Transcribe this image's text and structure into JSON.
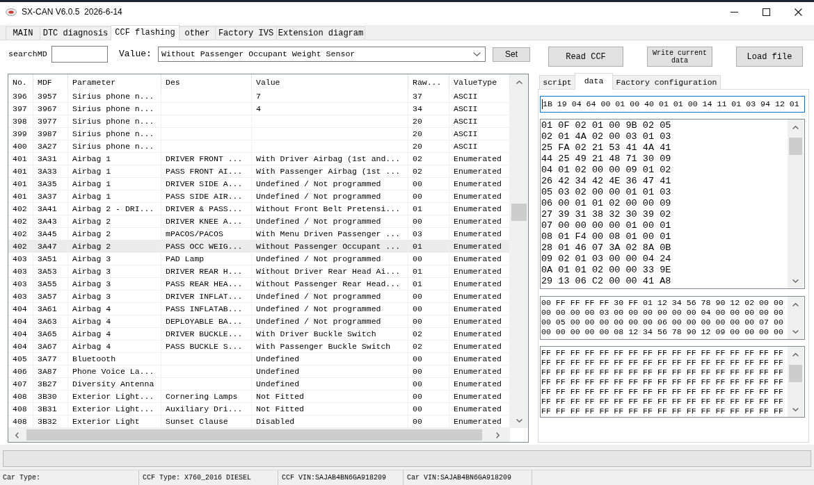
{
  "window": {
    "title": "SX-CAN V6.0.5  2026-6-14"
  },
  "tabs": [
    {
      "label": "MAIN",
      "selected": false
    },
    {
      "label": "DTC diagnosis",
      "selected": false
    },
    {
      "label": "CCF flashing",
      "selected": true
    },
    {
      "label": "other",
      "selected": false
    },
    {
      "label": "Factory IVS",
      "selected": false
    },
    {
      "label": "Extension diagram",
      "selected": false
    }
  ],
  "search": {
    "label": "searchMD"
  },
  "value_field": {
    "label": "Value:",
    "value": "Without Passenger Occupant Weight Sensor"
  },
  "set_button": "Set",
  "action_buttons": [
    "Read CCF",
    "Write current data",
    "Load file"
  ],
  "table": {
    "columns": [
      "No.",
      "MDF",
      "Parameter",
      "Des",
      "Value",
      "Raw...",
      "ValueType"
    ],
    "rows": [
      {
        "no": "396",
        "mdf": "3957",
        "parameter": "Sirius phone n...",
        "value": "7",
        "raw": "37",
        "value_type": "ASCII",
        "selected": false
      },
      {
        "no": "397",
        "mdf": "3967",
        "parameter": "Sirius phone n...",
        "value": "4",
        "raw": "34",
        "value_type": "ASCII",
        "selected": false
      },
      {
        "no": "398",
        "mdf": "3977",
        "parameter": "Sirius phone n...",
        "raw": "20",
        "value_type": "ASCII",
        "selected": false
      },
      {
        "no": "399",
        "mdf": "3987",
        "parameter": "Sirius phone n...",
        "raw": "20",
        "value_type": "ASCII",
        "selected": false
      },
      {
        "no": "400",
        "mdf": "3A27",
        "parameter": "Sirius phone n...",
        "raw": "20",
        "value_type": "ASCII",
        "selected": false
      },
      {
        "no": "401",
        "mdf": "3A31",
        "parameter": "Airbag 1",
        "des": "DRIVER FRONT ...",
        "value": "With Driver Airbag (1st and...",
        "raw": "02",
        "value_type": "Enumerated",
        "selected": false
      },
      {
        "no": "401",
        "mdf": "3A33",
        "parameter": "Airbag 1",
        "des": "PASS FRONT AI...",
        "value": "With Passenger Airbag (1st ...",
        "raw": "02",
        "value_type": "Enumerated",
        "selected": false
      },
      {
        "no": "401",
        "mdf": "3A35",
        "parameter": "Airbag 1",
        "des": "DRIVER SIDE A...",
        "value": "Undefined / Not programmed",
        "raw": "00",
        "value_type": "Enumerated",
        "selected": false
      },
      {
        "no": "401",
        "mdf": "3A37",
        "parameter": "Airbag 1",
        "des": "PASS SIDE AIR...",
        "value": "Undefined / Not programmed",
        "raw": "00",
        "value_type": "Enumerated",
        "selected": false
      },
      {
        "no": "402",
        "mdf": "3A41",
        "parameter": "Airbag 2 - DRI...",
        "des": "DRIVER & PASS...",
        "value": "Without Front Belt Pretensi...",
        "raw": "01",
        "value_type": "Enumerated",
        "selected": false
      },
      {
        "no": "402",
        "mdf": "3A43",
        "parameter": "Airbag 2",
        "des": "DRIVER KNEE A...",
        "value": "Undefined / Not programmed",
        "raw": "00",
        "value_type": "Enumerated",
        "selected": false
      },
      {
        "no": "402",
        "mdf": "3A45",
        "parameter": "Airbag 2",
        "des": "mPACOS/PACOS",
        "value": "With Menu Driven Passenger ...",
        "raw": "03",
        "value_type": "Enumerated",
        "selected": false
      },
      {
        "no": "402",
        "mdf": "3A47",
        "parameter": "Airbag 2",
        "des": "PASS OCC WEIG...",
        "value": "Without Passenger Occupant ...",
        "raw": "01",
        "value_type": "Enumerated",
        "selected": true
      },
      {
        "no": "403",
        "mdf": "3A51",
        "parameter": "Airbag 3",
        "des": "PAD Lamp",
        "value": "Undefined / Not programmed",
        "raw": "00",
        "value_type": "Enumerated",
        "selected": false
      },
      {
        "no": "403",
        "mdf": "3A53",
        "parameter": "Airbag 3",
        "des": "DRIVER REAR H...",
        "value": "Without Driver Rear Head Ai...",
        "raw": "01",
        "value_type": "Enumerated",
        "selected": false
      },
      {
        "no": "403",
        "mdf": "3A55",
        "parameter": "Airbag 3",
        "des": "PASS REAR HEA...",
        "value": "Without Passenger Rear Head...",
        "raw": "01",
        "value_type": "Enumerated",
        "selected": false
      },
      {
        "no": "403",
        "mdf": "3A57",
        "parameter": "Airbag 3",
        "des": "DRIVER INFLAT...",
        "value": "Undefined / Not programmed",
        "raw": "00",
        "value_type": "Enumerated",
        "selected": false
      },
      {
        "no": "404",
        "mdf": "3A61",
        "parameter": "Airbag 4",
        "des": "PASS INFLATAB...",
        "value": "Undefined / Not programmed",
        "raw": "00",
        "value_type": "Enumerated",
        "selected": false
      },
      {
        "no": "404",
        "mdf": "3A63",
        "parameter": "Airbag 4",
        "des": "DEPLOYABLE BA...",
        "value": "Undefined / Not programmed",
        "raw": "00",
        "value_type": "Enumerated",
        "selected": false
      },
      {
        "no": "404",
        "mdf": "3A65",
        "parameter": "Airbag 4",
        "des": "DRIVER BUCKLE...",
        "value": "With Driver Buckle Switch",
        "raw": "02",
        "value_type": "Enumerated",
        "selected": false
      },
      {
        "no": "404",
        "mdf": "3A67",
        "parameter": "Airbag 4",
        "des": "PASS BUCKLE S...",
        "value": "With Passenger Buckle Switch",
        "raw": "02",
        "value_type": "Enumerated",
        "selected": false
      },
      {
        "no": "405",
        "mdf": "3A77",
        "parameter": "Bluetooth",
        "value": "Undefined",
        "raw": "00",
        "value_type": "Enumerated",
        "selected": false
      },
      {
        "no": "406",
        "mdf": "3A87",
        "parameter": "Phone Voice La...",
        "value": "Undefined",
        "raw": "00",
        "value_type": "Enumerated",
        "selected": false
      },
      {
        "no": "407",
        "mdf": "3B27",
        "parameter": "Diversity Antenna",
        "value": "Undefined",
        "raw": "00",
        "value_type": "Enumerated",
        "selected": false
      },
      {
        "no": "408",
        "mdf": "3B30",
        "parameter": "Exterior Light...",
        "des": "Cornering Lamps",
        "value": "Not Fitted",
        "raw": "00",
        "value_type": "Enumerated",
        "selected": false
      },
      {
        "no": "408",
        "mdf": "3B31",
        "parameter": "Exterior Light...",
        "des": "Auxiliary Dri...",
        "value": "Not Fitted",
        "raw": "00",
        "value_type": "Enumerated",
        "selected": false
      },
      {
        "no": "408",
        "mdf": "3B32",
        "parameter": "Exterior Light",
        "des": "Sunset Clause",
        "value": "Disabled",
        "raw": "00",
        "value_type": "Enumerated",
        "selected": false
      }
    ]
  },
  "data_tabs": [
    {
      "label": "script",
      "selected": false
    },
    {
      "label": "data",
      "selected": true
    },
    {
      "label": "Factory configuration",
      "selected": false
    }
  ],
  "data_field": {
    "value": "1B 19 04 64 00 01 00 40 01 01 00 14 11 01 03 94 12 01",
    "focused": true
  },
  "hex_boxes": [
    {
      "lines": [
        "01 0F 02 01 00 9B 02 05",
        "02 01 4A 02 00 03 01 03",
        "25 FA 02 21 53 41 4A 41",
        "44 25 49 21 48 71 30 09",
        "04 01 02 00 00 09 01 02",
        "26 42 34 42 4E 36 47 41",
        "05 03 02 00 00 01 01 03",
        "06 00 01 01 02 00 00 09",
        "27 39 31 38 32 30 39 02",
        "07 00 00 00 00 01 00 01",
        "08 01 F4 00 08 01 00 01",
        "28 01 46 07 3A 02 8A 0B",
        "09 02 01 03 00 00 04 24",
        "0A 01 01 02 00 00 33 9E",
        "29 13 06 C2 00 00 41 A8"
      ]
    },
    {
      "lines": [
        "00 FF FF FF FF 30 FF 01 12 34 56 78 90 12 02 00 00",
        "00 00 00 00 03 00 00 00 00 00 00 04 00 00 00 00 00",
        "00 05 00 00 00 00 00 00 06 00 00 00 00 00 00 07 00",
        "00 00 00 00 00 08 12 34 56 78 90 12 09 00 00 00 00"
      ]
    },
    {
      "lines": [
        "FF FF FF FF FF FF FF FF FF FF FF FF FF FF FF FF FF",
        "FF FF FF FF FF FF FF FF FF FF FF FF FF FF FF FF FF",
        "FF FF FF FF FF FF FF FF FF FF FF FF FF FF FF FF FF",
        "FF FF FF FF FF FF FF FF FF FF FF FF FF FF FF FF FF",
        "FF FF FF FF FF FF FF FF FF FF FF FF FF FF FF FF FF",
        "FF FF FF FF FF FF FF FF FF FF FF FF FF FF FF FF FF",
        "FF FF FF FF FF FF FF FF FF FF FF FF FF FF FF FF FF"
      ]
    }
  ],
  "status_bar": [
    "Car Type:",
    "CCF Type: X760_2016 DIESEL",
    "CCF VIN:SAJAB4BN6GA918209",
    "Car VIN:SAJAB4BN6GA918209"
  ]
}
